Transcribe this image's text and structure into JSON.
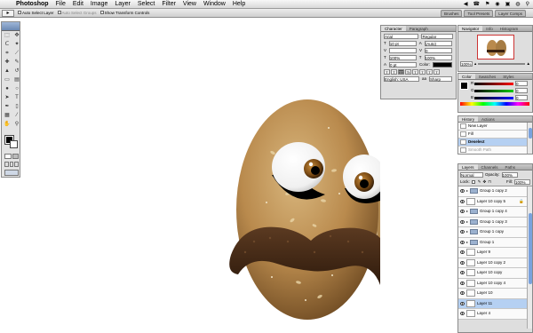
{
  "menubar": {
    "app": "Photoshop",
    "items": [
      "File",
      "Edit",
      "Image",
      "Layer",
      "Select",
      "Filter",
      "View",
      "Window",
      "Help"
    ],
    "right": [
      "◀",
      "☎",
      "⚑",
      "◉",
      "▣",
      "◍",
      "⚲"
    ]
  },
  "options": {
    "auto_select_layer": "Auto Select Layer",
    "auto_select_groups": "Auto Select Groups",
    "show_transform": "Show Transform Controls",
    "dock_tabs": [
      "Brushes",
      "Tool Presets",
      "Layer Comps"
    ]
  },
  "character": {
    "tabs": [
      "Character",
      "Paragraph"
    ],
    "font": "Arial",
    "style": "Regular",
    "size": "10 pt",
    "leading": "(Auto)",
    "tracking": "0",
    "scale_v": "100%",
    "scale_h": "100%",
    "baseline": "0 pt",
    "color_label": "Color:",
    "language": "English: USA",
    "aa": "Sharp"
  },
  "navigator": {
    "tabs": [
      "Navigator",
      "Info",
      "Histogram"
    ],
    "zoom": "100%"
  },
  "color": {
    "tabs": [
      "Color",
      "Swatches",
      "Styles"
    ],
    "r": "0",
    "g": "0",
    "b": "0"
  },
  "history": {
    "tabs": [
      "History",
      "Actions"
    ],
    "items": [
      "New Layer",
      "Fill",
      "Deselect",
      "Smooth Path"
    ]
  },
  "layers": {
    "tabs": [
      "Layers",
      "Channels",
      "Paths"
    ],
    "blend": "Normal",
    "opacity_label": "Opacity:",
    "opacity": "100%",
    "lock_label": "Lock:",
    "fill_label": "Fill:",
    "fill": "100%",
    "rows": [
      {
        "name": "Group 1 copy 2",
        "kind": "folder",
        "sel": false
      },
      {
        "name": "Layer 10 copy 5",
        "kind": "layer",
        "sel": false
      },
      {
        "name": "Group 1 copy 4",
        "kind": "folder",
        "sel": false
      },
      {
        "name": "Group 1 copy 3",
        "kind": "folder",
        "sel": false
      },
      {
        "name": "Group 1 copy",
        "kind": "folder",
        "sel": false
      },
      {
        "name": "Group 1",
        "kind": "folder",
        "sel": false
      },
      {
        "name": "Layer 9",
        "kind": "layer",
        "sel": false
      },
      {
        "name": "Layer 10 copy 2",
        "kind": "layer",
        "sel": false
      },
      {
        "name": "Layer 10 copy",
        "kind": "layer",
        "sel": false
      },
      {
        "name": "Layer 10 copy 4",
        "kind": "layer",
        "sel": false
      },
      {
        "name": "Layer 10",
        "kind": "layer",
        "sel": false
      },
      {
        "name": "Layer 11",
        "kind": "layer",
        "sel": true
      },
      {
        "name": "Layer 4",
        "kind": "layer",
        "sel": false
      }
    ]
  },
  "colors": {
    "accent": "#7aa2dd",
    "selection": "#b5d0f2"
  }
}
